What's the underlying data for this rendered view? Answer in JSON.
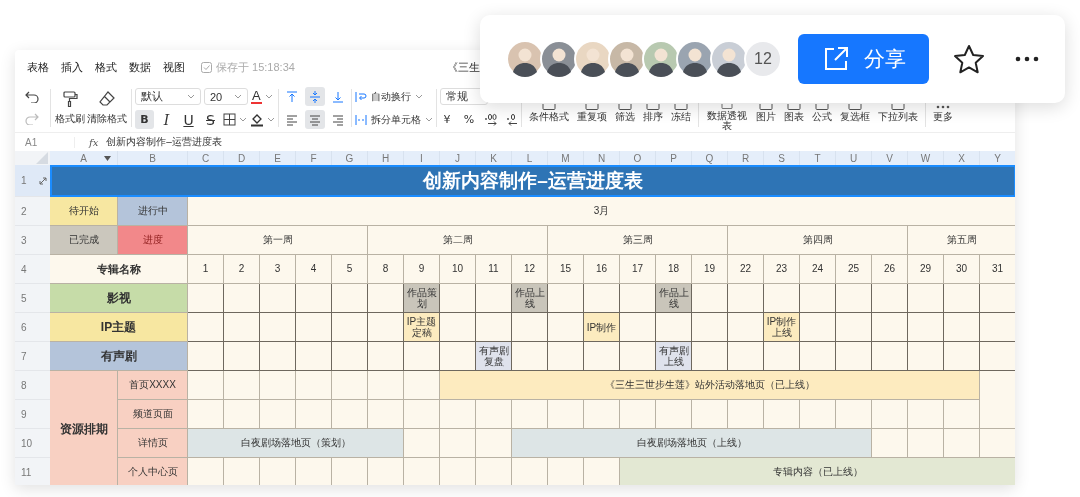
{
  "menu": [
    "表格",
    "插入",
    "格式",
    "数据",
    "视图"
  ],
  "save_status": "保存于 15:18:34",
  "doc_title": "《三生",
  "toolbar": {
    "painter": "格式刷",
    "clear": "清除格式",
    "font": "默认",
    "size": "20",
    "font_color": "A",
    "styles": [
      {
        "kind": "bold",
        "label": "B",
        "active": true
      },
      {
        "kind": "italic",
        "label": "I",
        "active": false
      },
      {
        "kind": "underline",
        "label": "U",
        "active": false
      },
      {
        "kind": "strike",
        "label": "S",
        "active": false
      }
    ],
    "valign": [
      {
        "kind": "top",
        "active": false
      },
      {
        "kind": "middle",
        "active": true
      },
      {
        "kind": "bottom",
        "active": false
      }
    ],
    "halign": [
      {
        "kind": "left",
        "active": false
      },
      {
        "kind": "center",
        "active": true
      },
      {
        "kind": "right",
        "active": false
      }
    ],
    "wrap": "自动换行",
    "split": "拆分单元格",
    "number_format": "常规",
    "currency": "¥",
    "percent": "%",
    "tools": [
      "条件格式",
      "重复项",
      "筛选",
      "排序",
      "冻结"
    ],
    "insert_tools": [
      "数据透视表",
      "图片",
      "图表",
      "公式",
      "复选框",
      "下拉列表"
    ],
    "more": "更多"
  },
  "formula_bar": {
    "cell": "A1",
    "fx": "fx",
    "formula": "创新内容制作–运营进度表"
  },
  "share": {
    "count": "12",
    "button": "分享"
  },
  "sheet": {
    "columns": [
      "A",
      "B",
      "C",
      "D",
      "E",
      "F",
      "G",
      "H",
      "I",
      "J",
      "K",
      "L",
      "M",
      "N",
      "O",
      "P",
      "Q",
      "R",
      "S",
      "T",
      "U",
      "V",
      "W",
      "X",
      "Y"
    ],
    "rows": [
      "1",
      "2",
      "3",
      "4",
      "5",
      "6",
      "7",
      "8",
      "9",
      "10",
      "11"
    ],
    "title": "创新内容制作–运营进度表",
    "legend": [
      {
        "label": "待开始",
        "color": "#f7e7a1"
      },
      {
        "label": "进行中",
        "color": "#b4c4da"
      },
      {
        "label": "已完成",
        "color": "#cbc7bd"
      },
      {
        "label": "进度",
        "color": "#f2888a"
      }
    ],
    "month": "3月",
    "days_heading": "专辑名称",
    "weeks": [
      {
        "label": "第一周",
        "days": [
          "1",
          "2",
          "3",
          "4",
          "5"
        ]
      },
      {
        "label": "第二周",
        "days": [
          "8",
          "9",
          "10",
          "11",
          "12"
        ]
      },
      {
        "label": "第三周",
        "days": [
          "15",
          "16",
          "17",
          "18",
          "19"
        ]
      },
      {
        "label": "第四周",
        "days": [
          "22",
          "23",
          "24",
          "25",
          "26"
        ]
      },
      {
        "label": "第五周",
        "days": [
          "29",
          "30",
          "31"
        ]
      }
    ],
    "categories": [
      {
        "label": "影视",
        "color": "#c6dca8",
        "cells": [
          {
            "kind": "blank"
          },
          {
            "kind": "blank"
          },
          {
            "kind": "blank"
          },
          {
            "kind": "blank"
          },
          {
            "kind": "blank"
          },
          {
            "kind": "blank"
          },
          {
            "kind": "task",
            "text": "作品策划",
            "color": "#c9c5ba"
          },
          {
            "kind": "blank"
          },
          {
            "kind": "blank"
          },
          {
            "kind": "task",
            "text": "作品上线",
            "color": "#c9c5ba"
          },
          {
            "kind": "blank"
          },
          {
            "kind": "blank"
          },
          {
            "kind": "blank"
          },
          {
            "kind": "task",
            "text": "作品上线",
            "color": "#c9c5ba"
          },
          {
            "kind": "blank"
          },
          {
            "kind": "blank"
          },
          {
            "kind": "blank"
          },
          {
            "kind": "blank"
          },
          {
            "kind": "blank"
          },
          {
            "kind": "blank"
          },
          {
            "kind": "blank"
          },
          {
            "kind": "blank"
          },
          {
            "kind": "blank"
          }
        ]
      },
      {
        "label": "IP主题",
        "color": "#f7e7a1",
        "cells": [
          {
            "kind": "blank"
          },
          {
            "kind": "blank"
          },
          {
            "kind": "blank"
          },
          {
            "kind": "blank"
          },
          {
            "kind": "blank"
          },
          {
            "kind": "blank"
          },
          {
            "kind": "task",
            "text": "IP主题定稿",
            "color": "#fcebbf"
          },
          {
            "kind": "blank"
          },
          {
            "kind": "blank"
          },
          {
            "kind": "blank"
          },
          {
            "kind": "blank"
          },
          {
            "kind": "task",
            "text": "IP制作",
            "color": "#fcebbf"
          },
          {
            "kind": "blank"
          },
          {
            "kind": "blank"
          },
          {
            "kind": "blank"
          },
          {
            "kind": "blank"
          },
          {
            "kind": "task",
            "text": "IP制作上线",
            "color": "#fcebbf"
          },
          {
            "kind": "blank"
          },
          {
            "kind": "blank"
          },
          {
            "kind": "blank"
          },
          {
            "kind": "blank"
          },
          {
            "kind": "blank"
          },
          {
            "kind": "blank"
          }
        ]
      },
      {
        "label": "有声剧",
        "color": "#b4c4da",
        "cells": [
          {
            "kind": "blank"
          },
          {
            "kind": "blank"
          },
          {
            "kind": "blank"
          },
          {
            "kind": "blank"
          },
          {
            "kind": "blank"
          },
          {
            "kind": "blank"
          },
          {
            "kind": "blank"
          },
          {
            "kind": "blank"
          },
          {
            "kind": "task",
            "text": "有声剧复盘",
            "color": "#dfe2ec"
          },
          {
            "kind": "blank"
          },
          {
            "kind": "blank"
          },
          {
            "kind": "blank"
          },
          {
            "kind": "blank"
          },
          {
            "kind": "task",
            "text": "有声剧上线",
            "color": "#dfe2ec"
          },
          {
            "kind": "blank"
          },
          {
            "kind": "blank"
          },
          {
            "kind": "blank"
          },
          {
            "kind": "blank"
          },
          {
            "kind": "blank"
          },
          {
            "kind": "blank"
          },
          {
            "kind": "blank"
          },
          {
            "kind": "blank"
          },
          {
            "kind": "blank"
          }
        ]
      }
    ],
    "group": {
      "label": "资源排期",
      "color": "#f8d0c2",
      "rows": [
        {
          "label": "首页XXXX",
          "cells": [
            {
              "kind": "blank"
            },
            {
              "kind": "blank"
            },
            {
              "kind": "blank"
            },
            {
              "kind": "blank"
            },
            {
              "kind": "blank"
            },
            {
              "kind": "blank"
            },
            {
              "kind": "blank"
            },
            {
              "kind": "bar",
              "text": "《三生三世步生莲》站外活动落地页（已上线）",
              "color": "#fdebbf"
            },
            {
              "kind": "cont"
            },
            {
              "kind": "cont"
            },
            {
              "kind": "cont"
            },
            {
              "kind": "cont"
            },
            {
              "kind": "cont"
            },
            {
              "kind": "cont"
            },
            {
              "kind": "cont"
            },
            {
              "kind": "cont"
            },
            {
              "kind": "cont"
            },
            {
              "kind": "cont"
            },
            {
              "kind": "cont"
            },
            {
              "kind": "cont"
            },
            {
              "kind": "cont"
            },
            {
              "kind": "cont"
            }
          ]
        },
        {
          "label": "频道页面",
          "cells": [
            {
              "kind": "blank"
            },
            {
              "kind": "blank"
            },
            {
              "kind": "blank"
            },
            {
              "kind": "blank"
            },
            {
              "kind": "blank"
            },
            {
              "kind": "blank"
            },
            {
              "kind": "blank"
            },
            {
              "kind": "blank"
            },
            {
              "kind": "blank"
            },
            {
              "kind": "blank"
            },
            {
              "kind": "blank"
            },
            {
              "kind": "blank"
            },
            {
              "kind": "blank"
            },
            {
              "kind": "blank"
            },
            {
              "kind": "blank"
            },
            {
              "kind": "blank"
            },
            {
              "kind": "blank"
            },
            {
              "kind": "blank"
            },
            {
              "kind": "blank"
            },
            {
              "kind": "blank"
            },
            {
              "kind": "blank"
            },
            {
              "kind": "blank"
            },
            {
              "kind": "blank"
            }
          ]
        },
        {
          "label": "详情页",
          "cells": [
            {
              "kind": "bar",
              "text": "白夜剧场落地页（策划）",
              "color": "#dde5e6"
            },
            {
              "kind": "cont"
            },
            {
              "kind": "cont"
            },
            {
              "kind": "cont"
            },
            {
              "kind": "cont"
            },
            {
              "kind": "cont"
            },
            {
              "kind": "blank"
            },
            {
              "kind": "blank"
            },
            {
              "kind": "blank"
            },
            {
              "kind": "bar",
              "text": "白夜剧场落地页（上线）",
              "color": "#dde5e6"
            },
            {
              "kind": "cont"
            },
            {
              "kind": "cont"
            },
            {
              "kind": "cont"
            },
            {
              "kind": "cont"
            },
            {
              "kind": "cont"
            },
            {
              "kind": "cont"
            },
            {
              "kind": "cont"
            },
            {
              "kind": "cont"
            },
            {
              "kind": "cont"
            },
            {
              "kind": "blank"
            },
            {
              "kind": "blank"
            },
            {
              "kind": "blank"
            },
            {
              "kind": "blank"
            }
          ]
        },
        {
          "label": "个人中心页",
          "cells": [
            {
              "kind": "blank"
            },
            {
              "kind": "blank"
            },
            {
              "kind": "blank"
            },
            {
              "kind": "blank"
            },
            {
              "kind": "blank"
            },
            {
              "kind": "blank"
            },
            {
              "kind": "blank"
            },
            {
              "kind": "blank"
            },
            {
              "kind": "blank"
            },
            {
              "kind": "blank"
            },
            {
              "kind": "blank"
            },
            {
              "kind": "blank"
            },
            {
              "kind": "bar",
              "text": "专辑内容（已上线）",
              "color": "#e3e8d3"
            },
            {
              "kind": "cont"
            },
            {
              "kind": "cont"
            },
            {
              "kind": "cont"
            },
            {
              "kind": "cont"
            },
            {
              "kind": "cont"
            },
            {
              "kind": "cont"
            },
            {
              "kind": "cont"
            },
            {
              "kind": "cont"
            },
            {
              "kind": "cont"
            },
            {
              "kind": "cont"
            }
          ]
        }
      ]
    }
  }
}
